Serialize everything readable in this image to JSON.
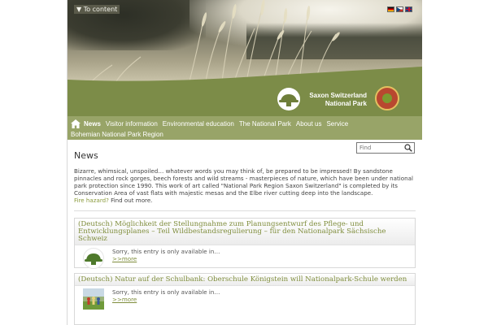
{
  "header": {
    "skip_link": "▼ To content",
    "languages": [
      "de",
      "cz",
      "en"
    ]
  },
  "branding": {
    "org_line1": "Saxon Switzerland",
    "org_line2": "National Park",
    "colors": {
      "banner": "#7c8c48",
      "nav": "#98a468",
      "accent": "#7f8d3c"
    }
  },
  "nav": {
    "home_icon": "home-icon",
    "items": [
      {
        "label": "News",
        "active": true
      },
      {
        "label": "Visitor information",
        "active": false
      },
      {
        "label": "Environmental education",
        "active": false
      },
      {
        "label": "The National Park",
        "active": false
      },
      {
        "label": "About us",
        "active": false
      },
      {
        "label": "Service",
        "active": false
      },
      {
        "label": "Bohemian National Park Region",
        "active": false
      }
    ]
  },
  "main": {
    "title": "News",
    "search_placeholder": "Find",
    "intro": "Bizarre, whimsical, unspoiled… whatever words you may think of, be prepared to be impressed! By sandstone pinnacles and rock gorges, beech forests and wild streams - masterpieces of nature, which have been under national park protection since 1990. This work of art called \"National Park Region Saxon Switzerland\" is completed by its Conservation Area of vast flats with majestic mesas and the Elbe river cutting deep into the landscape.",
    "fire_link": "Fire hazard?",
    "find_more": " Find out more."
  },
  "entries": [
    {
      "title": "(Deutsch) Möglichkeit der Stellungnahme zum Planungsentwurf des Pflege- und Entwicklungsplanes – Teil Wildbestandsregulierung – für den Nationalpark Sächsische Schweiz",
      "excerpt": "Sorry, this entry is only available in…",
      "more": ">>more",
      "thumb": "logo"
    },
    {
      "title": "(Deutsch) Natur auf der Schulbank: Oberschule Königstein will Nationalpark-Schule werden",
      "excerpt": "Sorry, this entry is only available in…",
      "more": ">>more",
      "thumb": "photo"
    }
  ]
}
